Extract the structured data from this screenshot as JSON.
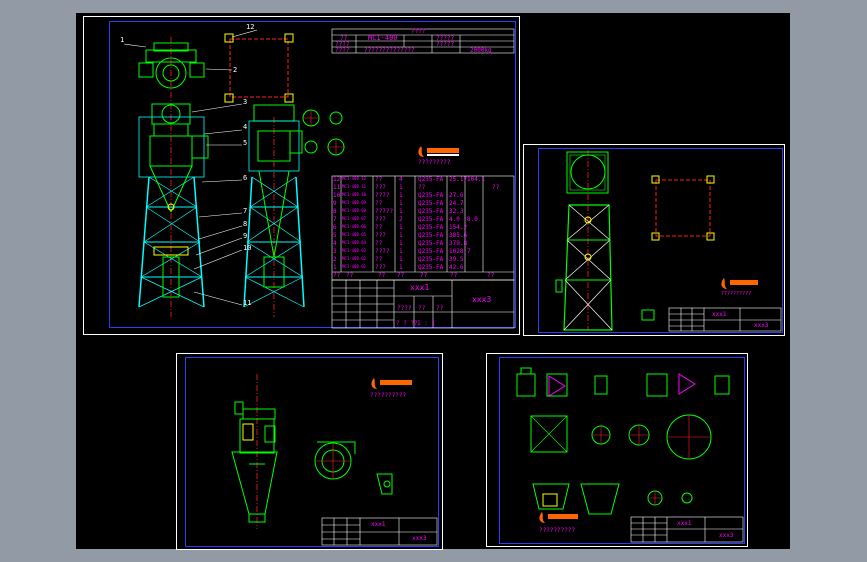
{
  "colors": {
    "background": "#000000",
    "outer": "#929aa6",
    "frame_border": "#2a3cff",
    "sheet_border": "#ffffff",
    "geometry": "#00ff00",
    "structure": "#00ffff",
    "dimension": "#ff00ff",
    "centerline": "#ff2020",
    "hatch": "#ffff00",
    "logo": "#ff6600"
  },
  "sheet1": {
    "title_block": {
      "row0": "????",
      "row1_a": "??",
      "row1_b": "MC1-400",
      "row1_c": "?????",
      "row2_a": "????",
      "row2_b": "?????",
      "row3_a": "????",
      "row3_b": "??????????????",
      "row3_c": "2000kg"
    },
    "balloons": [
      "1",
      "2",
      "3",
      "4",
      "5",
      "6",
      "7",
      "8",
      "9",
      "10",
      "11",
      "12"
    ],
    "logo_caption": "?????????",
    "parts_list": [
      {
        "no": "12",
        "code": "MC1-400-12",
        "name": "??",
        "qty": "4",
        "mat": "Q235-FA",
        "w1": "25.17",
        "w2": "104.1",
        "note": ""
      },
      {
        "no": "11",
        "code": "MC1-400-11",
        "name": "???",
        "qty": "1",
        "mat": "??",
        "w1": "",
        "w2": "",
        "note": "??"
      },
      {
        "no": "10",
        "code": "MC1-400-10",
        "name": "????",
        "qty": "1",
        "mat": "Q235-FA",
        "w1": "27.6",
        "w2": "",
        "note": ""
      },
      {
        "no": "9",
        "code": "MC1-400-09",
        "name": "??",
        "qty": "1",
        "mat": "Q235-FA",
        "w1": "24.7",
        "w2": "",
        "note": ""
      },
      {
        "no": "8",
        "code": "MC1-400-08",
        "name": "?????",
        "qty": "1",
        "mat": "Q235-FA",
        "w1": "32.3",
        "w2": "",
        "note": ""
      },
      {
        "no": "7",
        "code": "MC1-400-07",
        "name": "???",
        "qty": "2",
        "mat": "Q235-FA",
        "w1": "4.0",
        "w2": "8.0",
        "note": ""
      },
      {
        "no": "6",
        "code": "MC1-400-06",
        "name": "??",
        "qty": "1",
        "mat": "Q235-FA",
        "w1": "154.2",
        "w2": "",
        "note": ""
      },
      {
        "no": "5",
        "code": "MC1-400-05",
        "name": "???",
        "qty": "1",
        "mat": "Q235-FA",
        "w1": "385.6",
        "w2": "",
        "note": ""
      },
      {
        "no": "4",
        "code": "MC1-400-04",
        "name": "??",
        "qty": "1",
        "mat": "Q235-FA",
        "w1": "379.8",
        "w2": "",
        "note": ""
      },
      {
        "no": "3",
        "code": "MC1-400-03",
        "name": "????",
        "qty": "1",
        "mat": "Q235-FA",
        "w1": "1028.7",
        "w2": "",
        "note": ""
      },
      {
        "no": "2",
        "code": "MC1-400-02",
        "name": "??",
        "qty": "1",
        "mat": "Q235-FA",
        "w1": "39.5",
        "w2": "",
        "note": ""
      },
      {
        "no": "1",
        "code": "MC1-400-01",
        "name": "???",
        "qty": "1",
        "mat": "Q235-FA",
        "w1": "42.6",
        "w2": "",
        "note": ""
      }
    ],
    "parts_header": [
      "??",
      "??",
      "??",
      "??",
      "??",
      "??",
      "??"
    ],
    "name_block": {
      "xxx1": "xxx1",
      "xxx3": "xxx3",
      "sub_a": "????",
      "sub_b": "??",
      "sub_c": "??",
      "scale": "1 : 1",
      "sheet": "? ? ??"
    }
  },
  "sheet2": {
    "logo_caption": "??????????",
    "xxx1": "xxx1",
    "xxx3": "xxx3"
  },
  "sheet3": {
    "logo_caption": "??????????",
    "xxx1": "xxx1",
    "xxx3": "xxx3"
  },
  "sheet4": {
    "logo_caption": "??????????",
    "xxx1": "xxx1",
    "xxx3": "xxx3"
  }
}
